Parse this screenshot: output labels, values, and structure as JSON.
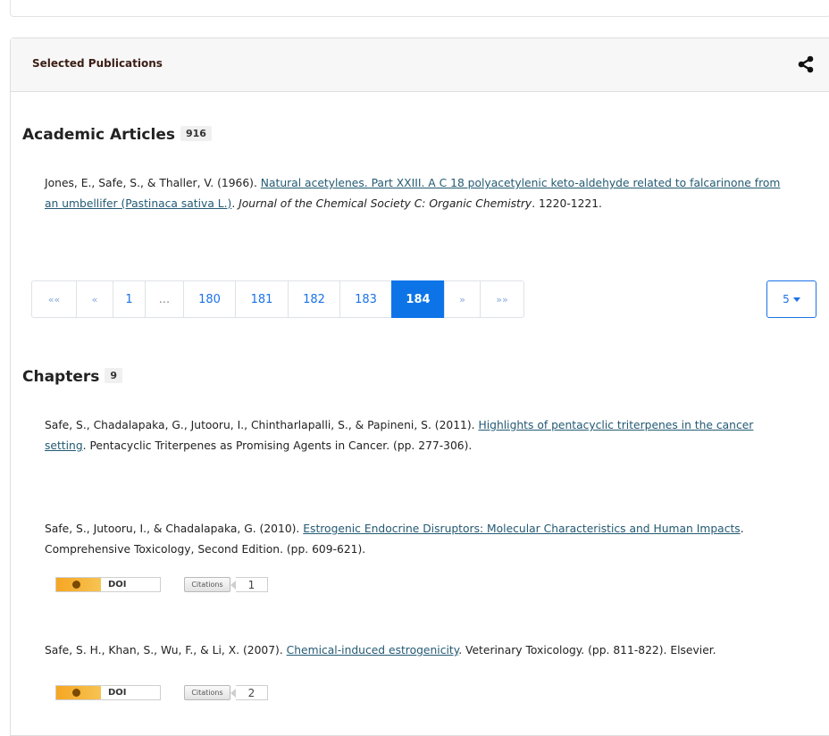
{
  "panel": {
    "title": "Selected Publications",
    "share_icon": "share-icon"
  },
  "articles": {
    "heading": "Academic Articles",
    "count": "916",
    "item": {
      "authors": "Jones, E., Safe, S., & Thaller, V. (1966). ",
      "title": "Natural acetylenes. Part XXIII. A C 18 polyacetylenic keto-aldehyde related to falcarinone from an umbellifer (Pastinaca sativa L.)",
      "after_title": ". ",
      "journal": "Journal of the Chemical Society C: Organic Chemistry",
      "pages": ". 1220-1221."
    }
  },
  "pagination": {
    "first": "««",
    "prev": "«",
    "page_1": "1",
    "ellipsis": "...",
    "page_180": "180",
    "page_181": "181",
    "page_182": "182",
    "page_183": "183",
    "page_184": "184",
    "next": "»",
    "last": "»»",
    "current": "184",
    "per_page": "5"
  },
  "chapters": {
    "heading": "Chapters",
    "count": "9",
    "items": [
      {
        "authors": "Safe, S., Chadalapaka, G., Jutooru, I., Chintharlapalli, S., & Papineni, S. (2011). ",
        "title": "Highlights of pentacyclic triterpenes in the cancer setting",
        "rest": ". Pentacyclic Triterpenes as Promising Agents in Cancer. (pp. 277-306)."
      },
      {
        "authors": "Safe, S., Jutooru, I., & Chadalapaka, G. (2010). ",
        "title": "Estrogenic Endocrine Disruptors: Molecular Characteristics and Human Impacts",
        "rest": ". Comprehensive Toxicology, Second Edition. (pp. 609-621).",
        "doi_label": "DOI",
        "citations_label": "Citations",
        "citations_count": "1"
      },
      {
        "authors": "Safe, S. H., Khan, S., Wu, F., & Li, X. (2007). ",
        "title": "Chemical-induced estrogenicity",
        "rest": ". Veterinary Toxicology. (pp. 811-822). Elsevier.",
        "doi_label": "DOI",
        "citations_label": "Citations",
        "citations_count": "2"
      }
    ]
  }
}
